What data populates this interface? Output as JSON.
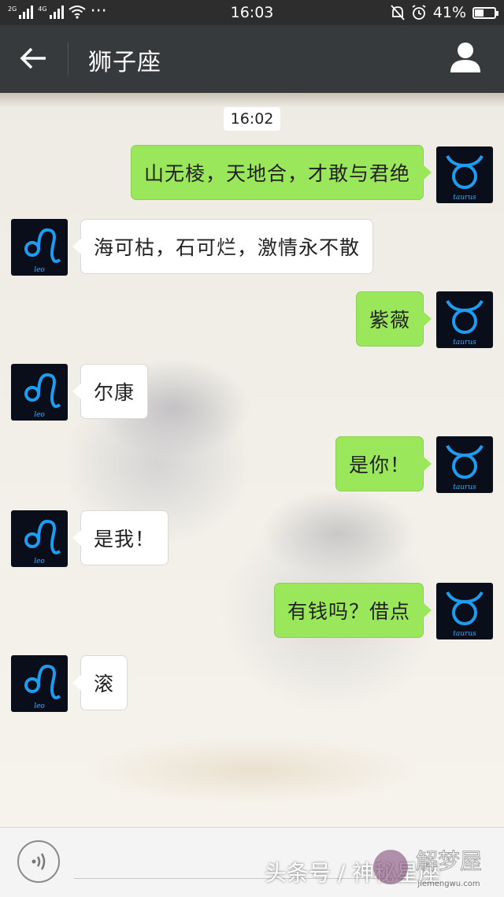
{
  "status_bar": {
    "signal1": "2G",
    "signal2": "4G",
    "dots": "···",
    "time": "16:03",
    "battery": "41%",
    "battery_level": 0.41
  },
  "header": {
    "title": "狮子座"
  },
  "chat": {
    "timestamp": "16:02",
    "messages": [
      {
        "side": "out",
        "text": "山无棱，天地合，才敢与君绝",
        "avatar": "taurus"
      },
      {
        "side": "in",
        "text": "海可枯，石可烂，激情永不散",
        "avatar": "leo"
      },
      {
        "side": "out",
        "text": "紫薇",
        "avatar": "taurus"
      },
      {
        "side": "in",
        "text": "尔康",
        "avatar": "leo"
      },
      {
        "side": "out",
        "text": "是你！",
        "avatar": "taurus"
      },
      {
        "side": "in",
        "text": "是我！",
        "avatar": "leo"
      },
      {
        "side": "out",
        "text": "有钱吗？借点",
        "avatar": "taurus"
      },
      {
        "side": "in",
        "text": "滚",
        "avatar": "leo"
      }
    ],
    "avatar_labels": {
      "taurus": "taurus",
      "leo": "leo"
    }
  },
  "input_bar": {
    "watermark": "头条号 / 神秘星座",
    "watermark_logo": "解梦屋",
    "watermark_url": "jiemengwu.com"
  },
  "colors": {
    "out_bubble": "#9be75c",
    "in_bubble": "#ffffff",
    "header_bg": "#373a3c",
    "zodiac_blue": "#1e9cf0"
  }
}
